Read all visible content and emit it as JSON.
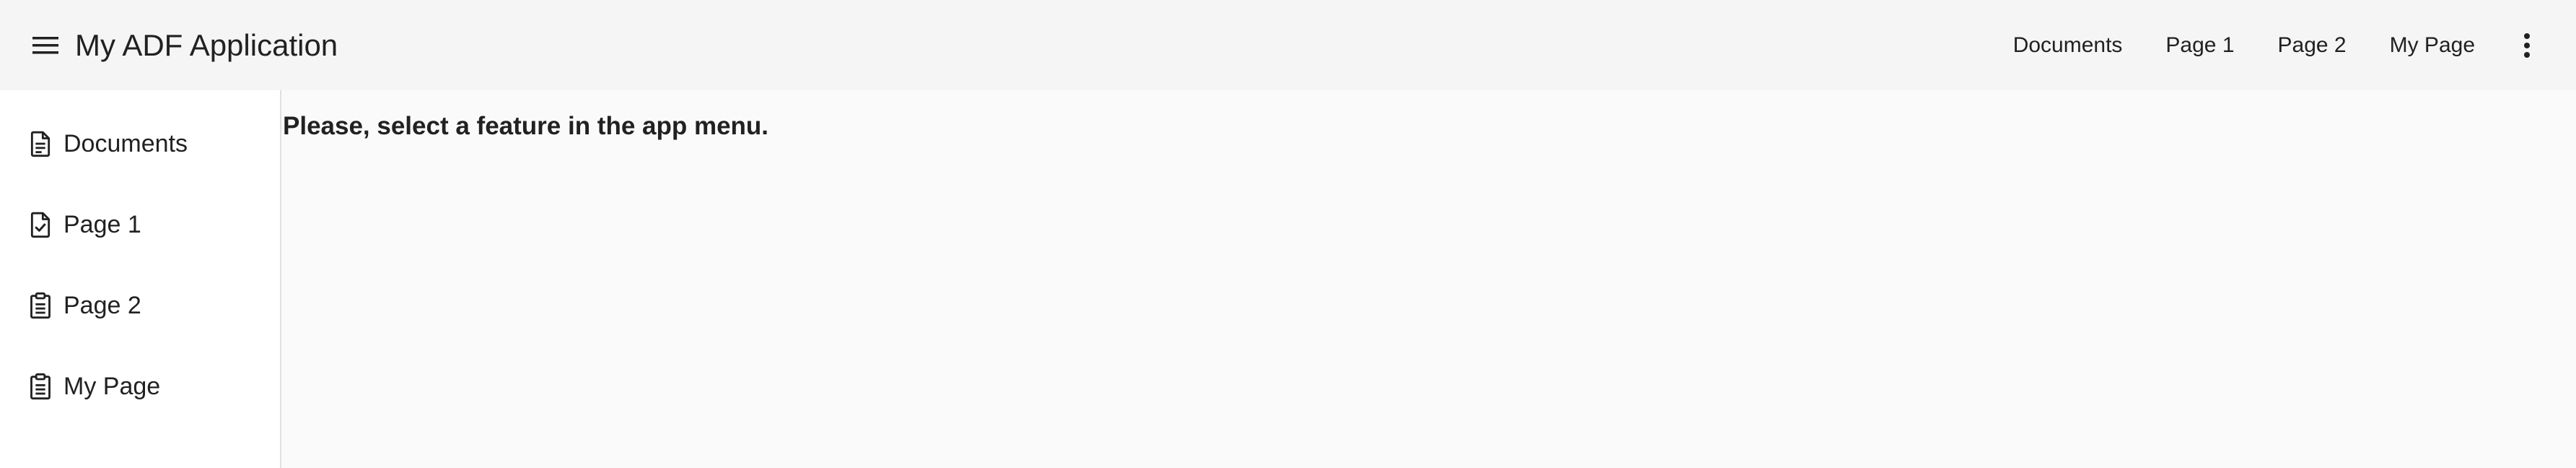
{
  "header": {
    "title": "My ADF Application",
    "menu_icon": "hamburger-menu-icon",
    "nav": [
      {
        "label": "Documents"
      },
      {
        "label": "Page 1"
      },
      {
        "label": "Page 2"
      },
      {
        "label": "My Page"
      }
    ],
    "more_icon": "more-vertical-icon"
  },
  "sidebar": {
    "items": [
      {
        "label": "Documents",
        "icon": "document-icon"
      },
      {
        "label": "Page 1",
        "icon": "file-check-icon"
      },
      {
        "label": "Page 2",
        "icon": "clipboard-icon"
      },
      {
        "label": "My Page",
        "icon": "clipboard-icon"
      }
    ]
  },
  "main": {
    "message": "Please, select a feature in the app menu."
  },
  "colors": {
    "toolbar_bg": "#f5f5f5",
    "sidebar_bg": "#ffffff",
    "content_bg": "#fafafa",
    "text": "#212121"
  }
}
